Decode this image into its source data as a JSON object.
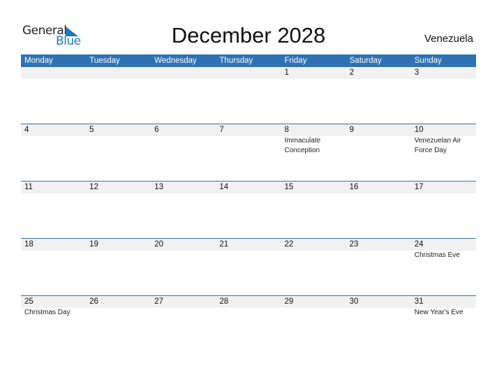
{
  "logo": {
    "text_general": "General",
    "text_blue": "Blue"
  },
  "header": {
    "title": "December 2028",
    "country": "Venezuela"
  },
  "colors": {
    "accent": "#2e72b3",
    "row_bg": "#f1f1f1",
    "logo_blue": "#1f78c1"
  },
  "weekdays": [
    "Monday",
    "Tuesday",
    "Wednesday",
    "Thursday",
    "Friday",
    "Saturday",
    "Sunday"
  ],
  "weeks": [
    {
      "days": [
        "",
        "",
        "",
        "",
        "1",
        "2",
        "3"
      ],
      "events": [
        "",
        "",
        "",
        "",
        "",
        "",
        ""
      ]
    },
    {
      "days": [
        "4",
        "5",
        "6",
        "7",
        "8",
        "9",
        "10"
      ],
      "events": [
        "",
        "",
        "",
        "",
        "Immaculate Conception",
        "",
        "Venezuelan Air Force Day"
      ]
    },
    {
      "days": [
        "11",
        "12",
        "13",
        "14",
        "15",
        "16",
        "17"
      ],
      "events": [
        "",
        "",
        "",
        "",
        "",
        "",
        ""
      ]
    },
    {
      "days": [
        "18",
        "19",
        "20",
        "21",
        "22",
        "23",
        "24"
      ],
      "events": [
        "",
        "",
        "",
        "",
        "",
        "",
        "Christmas Eve"
      ]
    },
    {
      "days": [
        "25",
        "26",
        "27",
        "28",
        "29",
        "30",
        "31"
      ],
      "events": [
        "Christmas Day",
        "",
        "",
        "",
        "",
        "",
        "New Year's Eve"
      ]
    }
  ]
}
